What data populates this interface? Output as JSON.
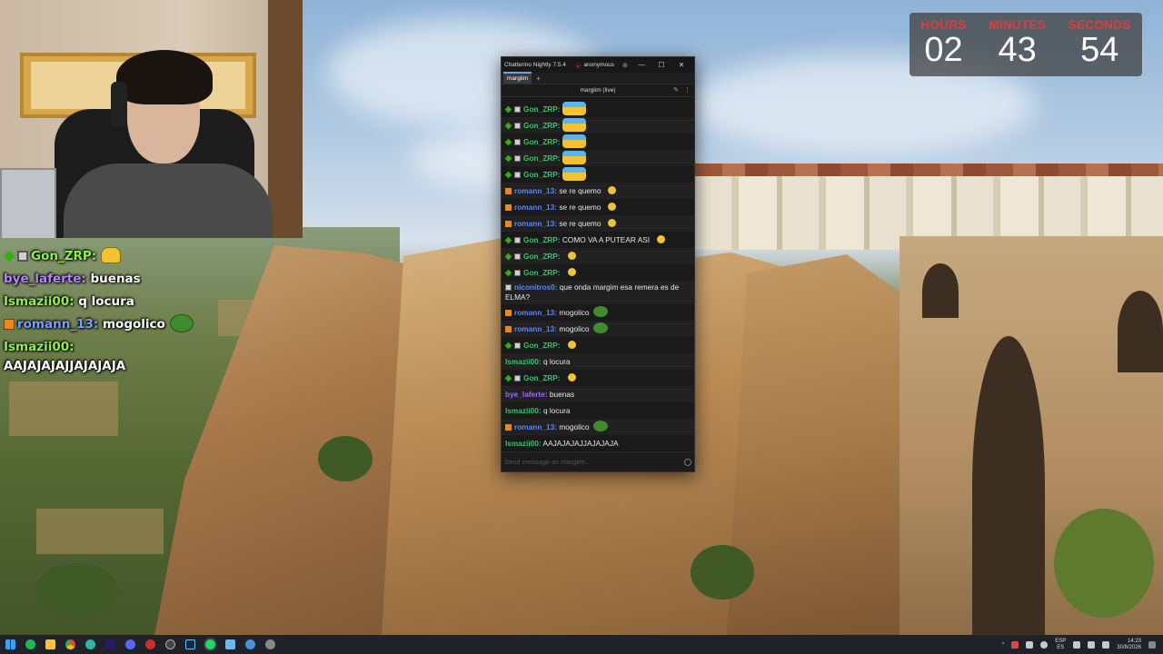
{
  "colors": {
    "countdown_label": "#e23b3b",
    "chat_bg": "#1a1a1a",
    "user_green": "#34c46a",
    "user_blue": "#5a86ff",
    "user_purple": "#a466ff"
  },
  "countdown": {
    "hours_label": "HOURS",
    "hours_value": "02",
    "minutes_label": "MINUTES",
    "minutes_value": "43",
    "seconds_label": "SECONDS",
    "seconds_value": "54"
  },
  "overlay_chat": [
    {
      "user": "Gon_ZRP:",
      "text": "",
      "emote": "wave-emote"
    },
    {
      "user": "bye_laferte:",
      "text": "buenas"
    },
    {
      "user": "Ismazii00:",
      "text": "q locura"
    },
    {
      "user": "romann_13:",
      "text": "mogolico",
      "emote": "peepo-emote"
    },
    {
      "user": "Ismazii00:",
      "text": ""
    },
    {
      "user": "",
      "text": "AAJAJAJAJJAJAJAJA"
    }
  ],
  "chatterino": {
    "title": "Chatterino Nightly 7.5.4",
    "account": "anonymous",
    "minimize": "—",
    "maximize": "☐",
    "close": "✕",
    "tab": "margiim",
    "tab_add": "+",
    "split_title": "margiim (live)",
    "input_placeholder": "Send message as margiim...",
    "messages": [
      {
        "user": "Gon_ZRP:",
        "text": ""
      },
      {
        "user": "Gon_ZRP:",
        "text": ""
      },
      {
        "user": "Gon_ZRP:",
        "text": ""
      },
      {
        "user": "Gon_ZRP:",
        "text": ""
      },
      {
        "user": "Gon_ZRP:",
        "text": ""
      },
      {
        "user": "romann_13:",
        "text": "se re quemo"
      },
      {
        "user": "romann_13:",
        "text": "se re quemo"
      },
      {
        "user": "romann_13:",
        "text": "se re quemo"
      },
      {
        "user": "Gon_ZRP:",
        "text": "COMO VA A PUTEAR ASI"
      },
      {
        "user": "Gon_ZRP:",
        "text": ""
      },
      {
        "user": "Gon_ZRP:",
        "text": ""
      },
      {
        "user": "niconitros0:",
        "text": "que onda margim esa remera es de ELMA?"
      },
      {
        "user": "romann_13:",
        "text": "mogolico"
      },
      {
        "user": "romann_13:",
        "text": "mogolico"
      },
      {
        "user": "Gon_ZRP:",
        "text": ""
      },
      {
        "user": "Ismazii00:",
        "text": "q locura"
      },
      {
        "user": "Gon_ZRP:",
        "text": ""
      },
      {
        "user": "bye_laferte:",
        "text": "buenas"
      },
      {
        "user": "Ismazii00:",
        "text": "q locura"
      },
      {
        "user": "romann_13:",
        "text": "mogolico"
      },
      {
        "user": "Ismazii00:",
        "text": "AAJAJAJAJJAJAJAJA"
      }
    ]
  },
  "taskbar": {
    "lang_top": "ESP",
    "lang_bottom": "ES",
    "time": "14:23",
    "date": "30/8/2026",
    "tray_chevron": "^"
  }
}
